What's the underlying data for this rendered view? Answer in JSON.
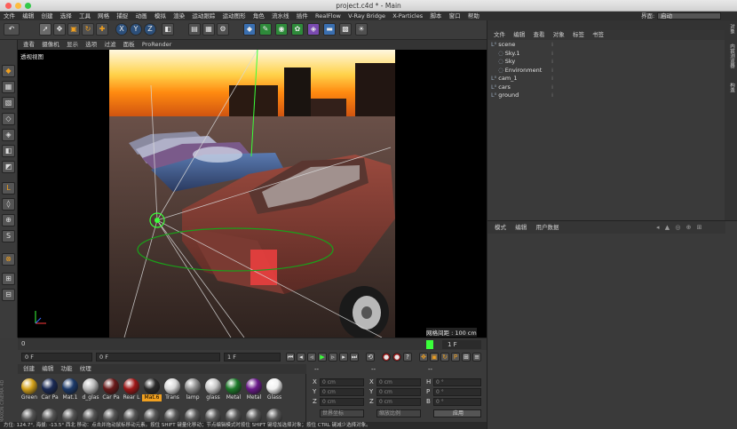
{
  "window": {
    "title": "project.c4d * - Main"
  },
  "menubar": [
    "文件",
    "编辑",
    "创建",
    "选择",
    "工具",
    "网格",
    "捕捉",
    "动画",
    "模拟",
    "渲染",
    "运动跟踪",
    "运动图形",
    "角色",
    "流水线",
    "插件",
    "RealFlow",
    "V-Ray Bridge",
    "X-Particles",
    "脚本",
    "窗口",
    "帮助"
  ],
  "layout": {
    "label": "界面:",
    "value": "启动"
  },
  "viewport": {
    "menu": [
      "查看",
      "摄像机",
      "显示",
      "选项",
      "过滤",
      "面板",
      "ProRender"
    ],
    "name": "透视视图",
    "grid_spacing": "网格间距 : 100 cm"
  },
  "timeline": {
    "start": "0",
    "frame_display": "1 F"
  },
  "transport": {
    "current_frame": "0 F",
    "start_field": "0 F",
    "end_field": "1 F"
  },
  "materials": {
    "menu": [
      "创建",
      "编辑",
      "功能",
      "纹理"
    ],
    "items": [
      {
        "label": "Green",
        "color": "#d4a21a"
      },
      {
        "label": "Car Pa",
        "color": "#1a2a55"
      },
      {
        "label": "Mat.1",
        "color": "#1c3a6a"
      },
      {
        "label": "d_glas",
        "color": "#b8b8b8"
      },
      {
        "label": "Car Pa",
        "color": "#6a1a1a"
      },
      {
        "label": "Rear L",
        "color": "#a01818"
      },
      {
        "label": "Mat.6",
        "color": "#2a2a2a",
        "selected": true
      },
      {
        "label": "Trans",
        "color": "#d8d8d8"
      },
      {
        "label": "lamp",
        "color": "#909090"
      },
      {
        "label": "glass",
        "color": "#c8c8c8"
      },
      {
        "label": "Metal",
        "color": "#1d7a2a"
      },
      {
        "label": "Metal",
        "color": "#6a1a8a"
      },
      {
        "label": "Glass",
        "color": "#f0f0f0"
      }
    ]
  },
  "coordinates": {
    "axes_left": [
      "X",
      "Y",
      "Z"
    ],
    "axes_mid": [
      "X",
      "Y",
      "Z"
    ],
    "axes_right": [
      "H",
      "P",
      "B"
    ],
    "value_cm": "0 cm",
    "value_deg": "0 °",
    "dropdown_1": "世界坐标",
    "dropdown_2": "缩放比例",
    "apply": "应用",
    "dashes": "--"
  },
  "object_manager": {
    "menu": [
      "文件",
      "编辑",
      "查看",
      "对象",
      "标签",
      "书签"
    ],
    "objects": [
      {
        "name": "scene",
        "level": 0
      },
      {
        "name": "Sky.1",
        "level": 1
      },
      {
        "name": "Sky",
        "level": 1
      },
      {
        "name": "Environment",
        "level": 1
      },
      {
        "name": "cam_1",
        "level": 0
      },
      {
        "name": "cars",
        "level": 0
      },
      {
        "name": "ground",
        "level": 0
      }
    ]
  },
  "attributes": {
    "menu": [
      "模式",
      "编辑",
      "用户数据"
    ]
  },
  "right_tabs": [
    "对象",
    "内容浏览器",
    "构造",
    "属性",
    "层"
  ],
  "status": "方位: 124.7°, 海拔: -13.5° 西北   移动：点击并拖动鼠标移动元素。按住 SHIFT 键量化移动；节点编辑模式时按住 SHIFT 键增加选择对象；按住 CTRL 键减少选择对象。",
  "brand": "MAXON CINEMA 4D",
  "colors": {
    "accent": "#f0a020",
    "bg": "#3a3a3a",
    "panel_dark": "#2b2b2b"
  }
}
